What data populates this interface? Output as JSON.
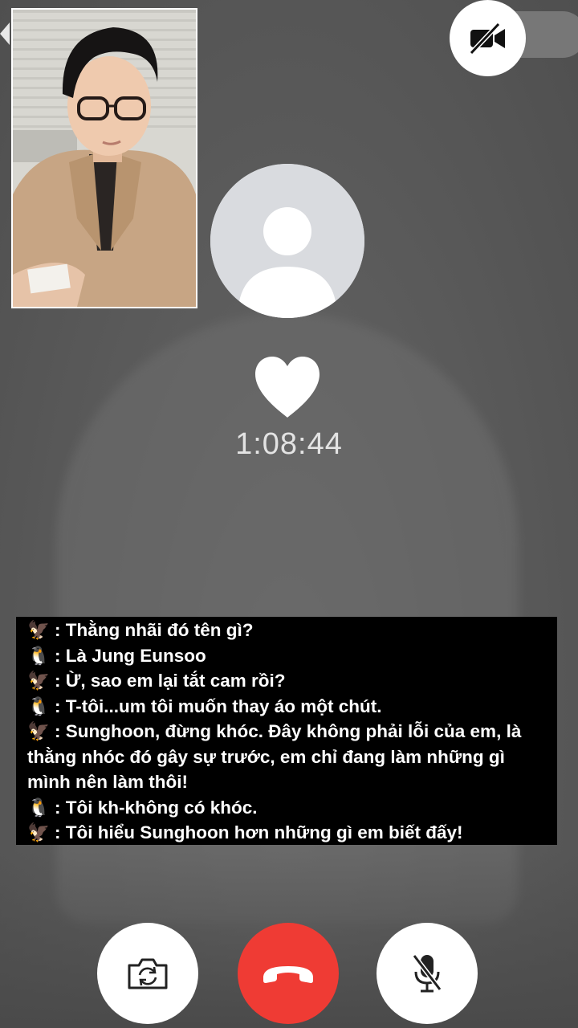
{
  "call": {
    "timer": "1:08:44"
  },
  "chat": {
    "lines": [
      {
        "speaker_icon": "🦅",
        "text": ": Thằng nhãi đó tên gì?"
      },
      {
        "speaker_icon": "🐧",
        "text": ": Là Jung Eunsoo"
      },
      {
        "speaker_icon": "🦅",
        "text": ": Ừ, sao em lại tắt cam rồi?"
      },
      {
        "speaker_icon": "🐧",
        "text": ": T-tôi...um tôi muốn thay áo một chút."
      },
      {
        "speaker_icon": "🦅",
        "text": ": Sunghoon, đừng khóc. Đây không phải lỗi của em, là thằng nhóc đó gây sự trước, em chỉ đang làm những gì mình nên làm thôi!"
      },
      {
        "speaker_icon": "🐧",
        "text": ": Tôi kh-không có khóc."
      },
      {
        "speaker_icon": "🦅",
        "text": ": Tôi hiểu Sunghoon hơn những gì em biết đấy!"
      }
    ]
  },
  "controls": {
    "camera_toggle_icon": "video-off-icon",
    "flip_icon": "camera-flip-icon",
    "end_icon": "phone-hangup-icon",
    "mute_icon": "mic-off-icon"
  },
  "colors": {
    "end_call": "#ef3b34",
    "background": "#5b5b5b",
    "chat_background": "#000000"
  }
}
